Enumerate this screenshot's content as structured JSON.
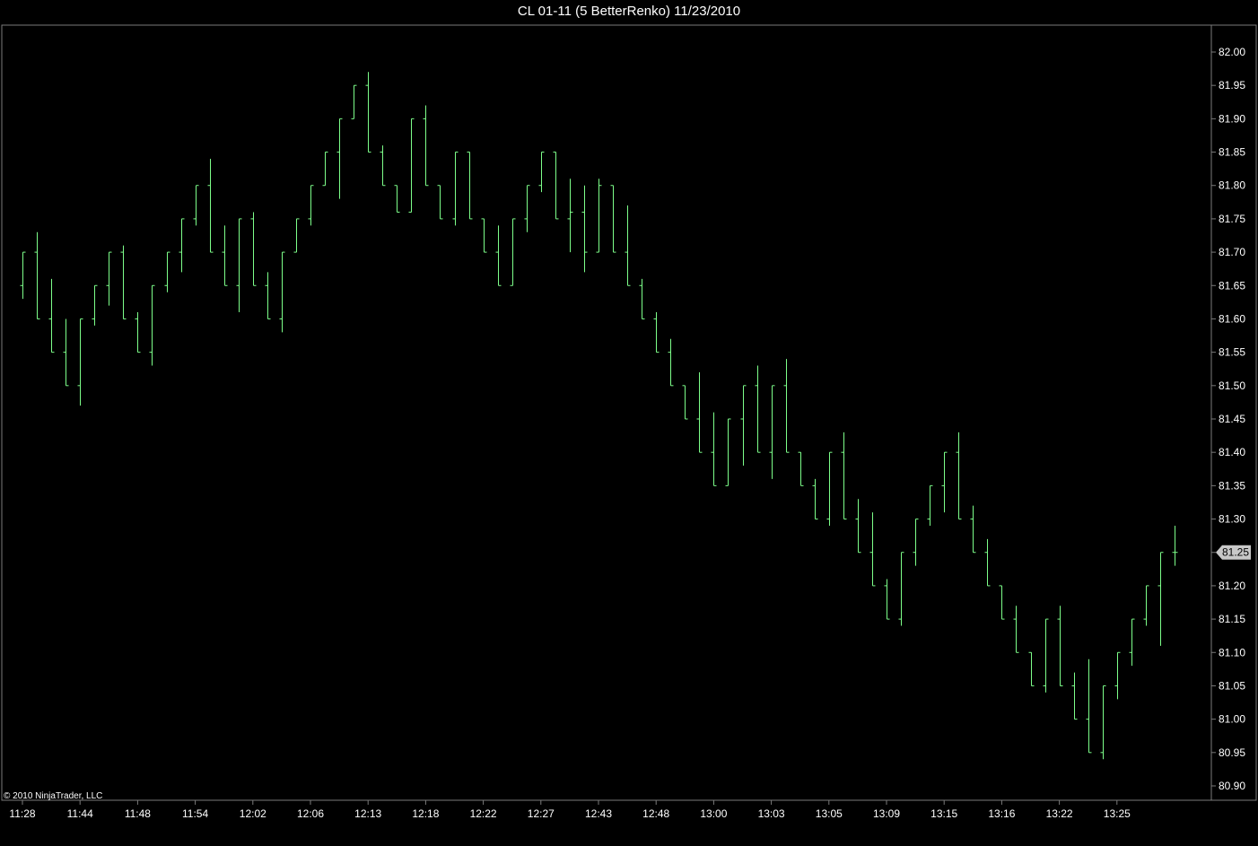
{
  "window": {
    "title": "CL 01-11 (5 BetterRenko)  11/23/2010",
    "copyright": "© 2010 NinjaTrader, LLC"
  },
  "colors": {
    "background": "#000000",
    "bar": "#7dff8a",
    "frame": "#7a7a7a",
    "text": "#ffffff",
    "price_marker_bg": "#c8c8c8",
    "price_marker_text": "#000000"
  },
  "chart_data": {
    "type": "ohlc",
    "title": "CL 01-11 (5 BetterRenko)  11/23/2010",
    "xlabel": "",
    "ylabel": "",
    "ylim": [
      80.875,
      82.025
    ],
    "y_ticks": [
      "82.00",
      "81.95",
      "81.90",
      "81.85",
      "81.80",
      "81.75",
      "81.70",
      "81.65",
      "81.60",
      "81.55",
      "81.50",
      "81.45",
      "81.40",
      "81.35",
      "81.30",
      "81.25",
      "81.20",
      "81.15",
      "81.10",
      "81.05",
      "81.00",
      "80.95",
      "80.90"
    ],
    "x_tick_labels": [
      {
        "bar": 0,
        "label": "11:28"
      },
      {
        "bar": 4,
        "label": "11:44"
      },
      {
        "bar": 8,
        "label": "11:48"
      },
      {
        "bar": 12,
        "label": "11:54"
      },
      {
        "bar": 16,
        "label": "12:02"
      },
      {
        "bar": 20,
        "label": "12:06"
      },
      {
        "bar": 24,
        "label": "12:13"
      },
      {
        "bar": 28,
        "label": "12:18"
      },
      {
        "bar": 32,
        "label": "12:22"
      },
      {
        "bar": 36,
        "label": "12:27"
      },
      {
        "bar": 40,
        "label": "12:43"
      },
      {
        "bar": 44,
        "label": "12:48"
      },
      {
        "bar": 48,
        "label": "13:00"
      },
      {
        "bar": 52,
        "label": "13:03"
      },
      {
        "bar": 56,
        "label": "13:05"
      },
      {
        "bar": 60,
        "label": "13:09"
      },
      {
        "bar": 64,
        "label": "13:15"
      },
      {
        "bar": 68,
        "label": "13:16"
      },
      {
        "bar": 72,
        "label": "13:22"
      },
      {
        "bar": 76,
        "label": "13:25"
      }
    ],
    "last_price": "81.25",
    "grid": false,
    "bars": [
      {
        "open": 81.65,
        "high": 81.7,
        "low": 81.63,
        "close": 81.7
      },
      {
        "open": 81.7,
        "high": 81.73,
        "low": 81.6,
        "close": 81.6
      },
      {
        "open": 81.6,
        "high": 81.66,
        "low": 81.55,
        "close": 81.55
      },
      {
        "open": 81.55,
        "high": 81.6,
        "low": 81.5,
        "close": 81.5
      },
      {
        "open": 81.5,
        "high": 81.6,
        "low": 81.47,
        "close": 81.6
      },
      {
        "open": 81.6,
        "high": 81.65,
        "low": 81.59,
        "close": 81.65
      },
      {
        "open": 81.65,
        "high": 81.7,
        "low": 81.62,
        "close": 81.7
      },
      {
        "open": 81.7,
        "high": 81.71,
        "low": 81.6,
        "close": 81.6
      },
      {
        "open": 81.6,
        "high": 81.61,
        "low": 81.55,
        "close": 81.55
      },
      {
        "open": 81.55,
        "high": 81.65,
        "low": 81.53,
        "close": 81.65
      },
      {
        "open": 81.65,
        "high": 81.7,
        "low": 81.64,
        "close": 81.7
      },
      {
        "open": 81.7,
        "high": 81.75,
        "low": 81.67,
        "close": 81.75
      },
      {
        "open": 81.75,
        "high": 81.8,
        "low": 81.74,
        "close": 81.8
      },
      {
        "open": 81.8,
        "high": 81.84,
        "low": 81.7,
        "close": 81.7
      },
      {
        "open": 81.7,
        "high": 81.74,
        "low": 81.65,
        "close": 81.65
      },
      {
        "open": 81.65,
        "high": 81.75,
        "low": 81.61,
        "close": 81.75
      },
      {
        "open": 81.75,
        "high": 81.76,
        "low": 81.65,
        "close": 81.65
      },
      {
        "open": 81.65,
        "high": 81.67,
        "low": 81.6,
        "close": 81.6
      },
      {
        "open": 81.6,
        "high": 81.7,
        "low": 81.58,
        "close": 81.7
      },
      {
        "open": 81.7,
        "high": 81.75,
        "low": 81.7,
        "close": 81.75
      },
      {
        "open": 81.75,
        "high": 81.8,
        "low": 81.74,
        "close": 81.8
      },
      {
        "open": 81.8,
        "high": 81.85,
        "low": 81.8,
        "close": 81.85
      },
      {
        "open": 81.85,
        "high": 81.9,
        "low": 81.78,
        "close": 81.9
      },
      {
        "open": 81.9,
        "high": 81.95,
        "low": 81.9,
        "close": 81.95
      },
      {
        "open": 81.95,
        "high": 81.97,
        "low": 81.85,
        "close": 81.85
      },
      {
        "open": 81.85,
        "high": 81.86,
        "low": 81.8,
        "close": 81.8
      },
      {
        "open": 81.8,
        "high": 81.8,
        "low": 81.76,
        "close": 81.76
      },
      {
        "open": 81.76,
        "high": 81.9,
        "low": 81.76,
        "close": 81.9
      },
      {
        "open": 81.9,
        "high": 81.92,
        "low": 81.8,
        "close": 81.8
      },
      {
        "open": 81.8,
        "high": 81.8,
        "low": 81.75,
        "close": 81.75
      },
      {
        "open": 81.75,
        "high": 81.85,
        "low": 81.74,
        "close": 81.85
      },
      {
        "open": 81.85,
        "high": 81.85,
        "low": 81.75,
        "close": 81.75
      },
      {
        "open": 81.75,
        "high": 81.75,
        "low": 81.7,
        "close": 81.7
      },
      {
        "open": 81.7,
        "high": 81.74,
        "low": 81.65,
        "close": 81.65
      },
      {
        "open": 81.65,
        "high": 81.75,
        "low": 81.65,
        "close": 81.75
      },
      {
        "open": 81.75,
        "high": 81.8,
        "low": 81.73,
        "close": 81.8
      },
      {
        "open": 81.8,
        "high": 81.85,
        "low": 81.79,
        "close": 81.85
      },
      {
        "open": 81.85,
        "high": 81.85,
        "low": 81.75,
        "close": 81.75
      },
      {
        "open": 81.75,
        "high": 81.81,
        "low": 81.7,
        "close": 81.76
      },
      {
        "open": 81.76,
        "high": 81.8,
        "low": 81.67,
        "close": 81.7
      },
      {
        "open": 81.7,
        "high": 81.81,
        "low": 81.7,
        "close": 81.8
      },
      {
        "open": 81.8,
        "high": 81.8,
        "low": 81.7,
        "close": 81.7
      },
      {
        "open": 81.7,
        "high": 81.77,
        "low": 81.65,
        "close": 81.65
      },
      {
        "open": 81.65,
        "high": 81.66,
        "low": 81.6,
        "close": 81.6
      },
      {
        "open": 81.6,
        "high": 81.61,
        "low": 81.55,
        "close": 81.55
      },
      {
        "open": 81.55,
        "high": 81.57,
        "low": 81.5,
        "close": 81.5
      },
      {
        "open": 81.5,
        "high": 81.5,
        "low": 81.45,
        "close": 81.45
      },
      {
        "open": 81.45,
        "high": 81.52,
        "low": 81.4,
        "close": 81.4
      },
      {
        "open": 81.4,
        "high": 81.46,
        "low": 81.35,
        "close": 81.35
      },
      {
        "open": 81.35,
        "high": 81.45,
        "low": 81.35,
        "close": 81.45
      },
      {
        "open": 81.45,
        "high": 81.5,
        "low": 81.38,
        "close": 81.5
      },
      {
        "open": 81.5,
        "high": 81.53,
        "low": 81.4,
        "close": 81.4
      },
      {
        "open": 81.4,
        "high": 81.5,
        "low": 81.36,
        "close": 81.5
      },
      {
        "open": 81.5,
        "high": 81.54,
        "low": 81.4,
        "close": 81.4
      },
      {
        "open": 81.4,
        "high": 81.4,
        "low": 81.35,
        "close": 81.35
      },
      {
        "open": 81.35,
        "high": 81.36,
        "low": 81.3,
        "close": 81.3
      },
      {
        "open": 81.3,
        "high": 81.4,
        "low": 81.29,
        "close": 81.4
      },
      {
        "open": 81.4,
        "high": 81.43,
        "low": 81.3,
        "close": 81.3
      },
      {
        "open": 81.3,
        "high": 81.33,
        "low": 81.25,
        "close": 81.25
      },
      {
        "open": 81.25,
        "high": 81.31,
        "low": 81.2,
        "close": 81.2
      },
      {
        "open": 81.2,
        "high": 81.21,
        "low": 81.15,
        "close": 81.15
      },
      {
        "open": 81.15,
        "high": 81.25,
        "low": 81.14,
        "close": 81.25
      },
      {
        "open": 81.25,
        "high": 81.3,
        "low": 81.23,
        "close": 81.3
      },
      {
        "open": 81.3,
        "high": 81.35,
        "low": 81.29,
        "close": 81.35
      },
      {
        "open": 81.35,
        "high": 81.4,
        "low": 81.31,
        "close": 81.4
      },
      {
        "open": 81.4,
        "high": 81.43,
        "low": 81.3,
        "close": 81.3
      },
      {
        "open": 81.3,
        "high": 81.32,
        "low": 81.25,
        "close": 81.25
      },
      {
        "open": 81.25,
        "high": 81.27,
        "low": 81.2,
        "close": 81.2
      },
      {
        "open": 81.2,
        "high": 81.2,
        "low": 81.15,
        "close": 81.15
      },
      {
        "open": 81.15,
        "high": 81.17,
        "low": 81.1,
        "close": 81.1
      },
      {
        "open": 81.1,
        "high": 81.1,
        "low": 81.05,
        "close": 81.05
      },
      {
        "open": 81.05,
        "high": 81.15,
        "low": 81.04,
        "close": 81.15
      },
      {
        "open": 81.15,
        "high": 81.17,
        "low": 81.05,
        "close": 81.05
      },
      {
        "open": 81.05,
        "high": 81.07,
        "low": 81.0,
        "close": 81.0
      },
      {
        "open": 81.0,
        "high": 81.09,
        "low": 80.95,
        "close": 80.95
      },
      {
        "open": 80.95,
        "high": 81.05,
        "low": 80.94,
        "close": 81.05
      },
      {
        "open": 81.05,
        "high": 81.1,
        "low": 81.03,
        "close": 81.1
      },
      {
        "open": 81.1,
        "high": 81.15,
        "low": 81.08,
        "close": 81.15
      },
      {
        "open": 81.15,
        "high": 81.2,
        "low": 81.14,
        "close": 81.2
      },
      {
        "open": 81.2,
        "high": 81.25,
        "low": 81.11,
        "close": 81.25
      },
      {
        "open": 81.25,
        "high": 81.29,
        "low": 81.23,
        "close": 81.25
      }
    ]
  }
}
